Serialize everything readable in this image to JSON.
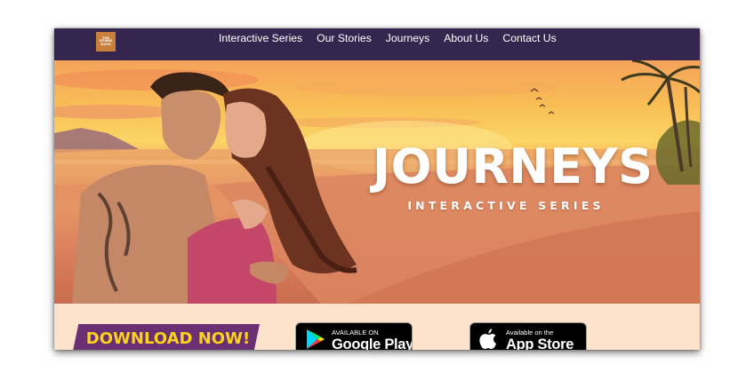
{
  "nav": {
    "logo_lines": [
      "THE",
      "OTHER",
      "GUYS"
    ],
    "items": [
      {
        "label": "Interactive Series"
      },
      {
        "label": "Our Stories"
      },
      {
        "label": "Journeys"
      },
      {
        "label": "About Us"
      },
      {
        "label": "Contact Us"
      }
    ]
  },
  "hero": {
    "title": "JOURNEYS",
    "subtitle": "INTERACTIVE SERIES"
  },
  "download": {
    "cta": "DOWNLOAD NOW!",
    "google_play": {
      "small": "AVAILABLE ON",
      "large": "Google Play",
      "icon": "google-play-icon"
    },
    "app_store": {
      "small": "Available on the",
      "large": "App Store",
      "icon": "apple-icon"
    }
  },
  "colors": {
    "nav_background": "#35264f",
    "strip_background": "#fde3cb",
    "banner_purple": "#6b2f73",
    "banner_yellow": "#fbd21c"
  }
}
